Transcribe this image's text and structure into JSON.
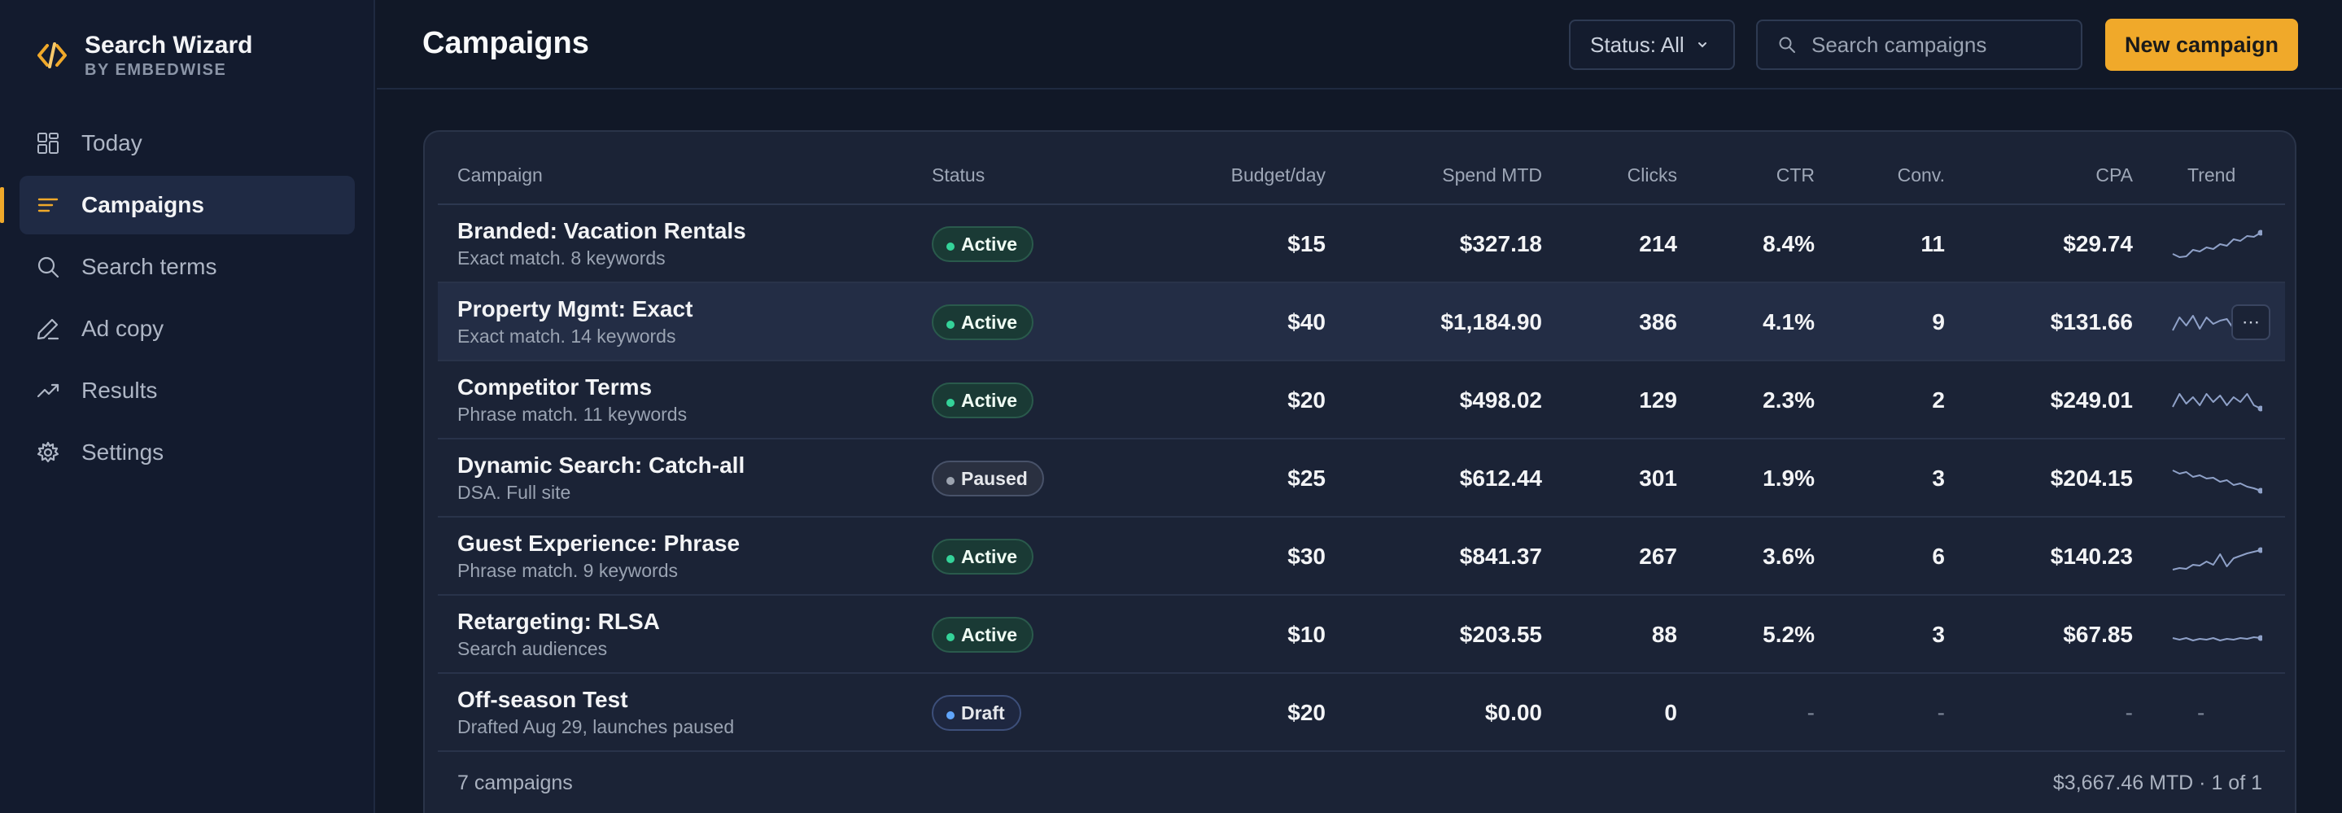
{
  "brand": {
    "name": "Search Wizard",
    "sub": "BY EMBEDWISE",
    "accent": "#f0a92a"
  },
  "nav": [
    {
      "label": "Today",
      "icon": "grid-icon"
    },
    {
      "label": "Campaigns",
      "icon": "list-icon",
      "active": true
    },
    {
      "label": "Search terms",
      "icon": "search-icon"
    },
    {
      "label": "Ad copy",
      "icon": "pencil-icon"
    },
    {
      "label": "Results",
      "icon": "trending-up-icon"
    },
    {
      "label": "Settings",
      "icon": "gear-icon"
    }
  ],
  "header": {
    "title": "Campaigns",
    "status_filter": "Status: All",
    "search_placeholder": "Search campaigns",
    "new_button": "New campaign"
  },
  "table": {
    "columns": [
      "Campaign",
      "Status",
      "Budget/day",
      "Spend MTD",
      "Clicks",
      "CTR",
      "Conv.",
      "CPA",
      "Trend"
    ],
    "rows": [
      {
        "name": "Branded: Vacation Rentals",
        "sub": "Exact match. 8 keywords",
        "status": "Active",
        "budget": "$15",
        "spend": "$327.18",
        "clicks": "214",
        "ctr": "8.4%",
        "conv": "11",
        "cpa": "$29.74",
        "trend": [
          30,
          34,
          33,
          25,
          27,
          22,
          24,
          18,
          20,
          12,
          14,
          8,
          9,
          4
        ]
      },
      {
        "name": "Property Mgmt: Exact",
        "sub": "Exact match. 14 keywords",
        "status": "Active",
        "budget": "$40",
        "spend": "$1,184.90",
        "clicks": "386",
        "ctr": "4.1%",
        "conv": "9",
        "cpa": "$131.66",
        "trend": [
          28,
          12,
          22,
          10,
          26,
          12,
          20,
          16,
          14,
          26,
          18,
          22,
          12,
          24
        ]
      },
      {
        "name": "Competitor Terms",
        "sub": "Phrase match. 11 keywords",
        "status": "Active",
        "budget": "$20",
        "spend": "$498.02",
        "clicks": "129",
        "ctr": "2.3%",
        "conv": "2",
        "cpa": "$249.01",
        "trend": [
          26,
          10,
          22,
          14,
          24,
          10,
          20,
          12,
          24,
          14,
          20,
          10,
          24,
          28
        ]
      },
      {
        "name": "Dynamic Search: Catch-all",
        "sub": "DSA. Full site",
        "status": "Paused",
        "budget": "$25",
        "spend": "$612.44",
        "clicks": "301",
        "ctr": "1.9%",
        "conv": "3",
        "cpa": "$204.15",
        "trend": [
          8,
          12,
          10,
          16,
          14,
          18,
          17,
          22,
          20,
          26,
          24,
          28,
          30,
          33
        ]
      },
      {
        "name": "Guest Experience: Phrase",
        "sub": "Phrase match. 9 keywords",
        "status": "Active",
        "budget": "$30",
        "spend": "$841.37",
        "clicks": "267",
        "ctr": "3.6%",
        "conv": "6",
        "cpa": "$140.23",
        "trend": [
          34,
          32,
          33,
          28,
          29,
          24,
          28,
          15,
          30,
          20,
          17,
          14,
          12,
          10
        ]
      },
      {
        "name": "Retargeting: RLSA",
        "sub": "Search audiences",
        "status": "Active",
        "budget": "$10",
        "spend": "$203.55",
        "clicks": "88",
        "ctr": "5.2%",
        "conv": "3",
        "cpa": "$67.85",
        "trend": [
          22,
          24,
          22,
          25,
          23,
          24,
          22,
          25,
          23,
          24,
          22,
          23,
          21,
          22
        ]
      },
      {
        "name": "Off-season Test",
        "sub": "Drafted Aug 29, launches paused",
        "status": "Draft",
        "budget": "$20",
        "spend": "$0.00",
        "clicks": "0",
        "ctr": "-",
        "conv": "-",
        "cpa": "-",
        "trend_text": "-"
      }
    ],
    "hover_row": 1,
    "more_label": "⋯"
  },
  "footer": {
    "count": "7 campaigns",
    "summary": "$3,667.46 MTD · 1 of 1"
  },
  "colors": {
    "trend_line": "#8fa1c8",
    "active": "#34d399",
    "paused": "#9ca3af",
    "draft": "#60a5fa"
  }
}
